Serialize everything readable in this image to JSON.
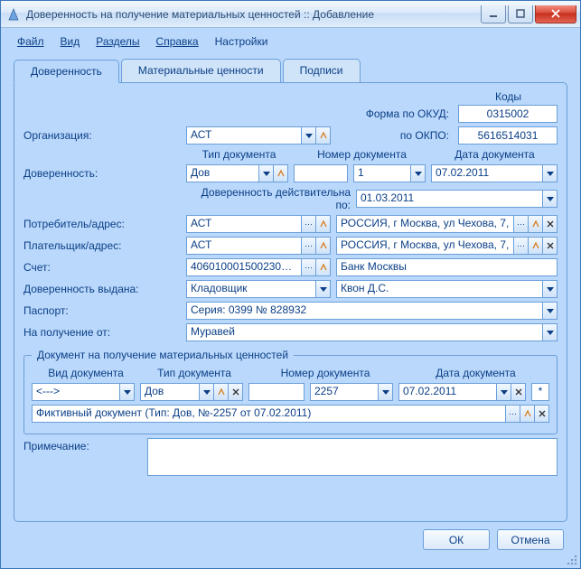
{
  "window": {
    "title": "Доверенность на получение материальных ценностей :: Добавление"
  },
  "menu": {
    "file": "Файл",
    "view": "Вид",
    "sections": "Разделы",
    "help": "Справка",
    "settings": "Настройки"
  },
  "tabs": {
    "t1": "Доверенность",
    "t2": "Материальные ценности",
    "t3": "Подписи"
  },
  "codes": {
    "header": "Коды",
    "okud_label": "Форма по ОКУД:",
    "okud_value": "0315002",
    "okpo_label": "по ОКПО:",
    "okpo_value": "5616514031"
  },
  "labels": {
    "org": "Организация:",
    "type": "Тип документа",
    "number": "Номер документа",
    "date": "Дата документа",
    "warrant": "Доверенность:",
    "valid_till": "Доверенность действительна по:",
    "consumer": "Потребитель/адрес:",
    "payer": "Плательщик/адрес:",
    "account": "Счет:",
    "issued_to": "Доверенность выдана:",
    "passport": "Паспорт:",
    "from": "На получение от:",
    "sub_legend": "Документ на получение материальных ценностей",
    "sub_vid": "Вид документа",
    "sub_type": "Тип документа",
    "sub_num": "Номер документа",
    "sub_date": "Дата документа",
    "note": "Примечание:"
  },
  "values": {
    "org": "АСТ",
    "warrant_type": "Дов",
    "warrant_num_left": "",
    "warrant_num_right": "1",
    "warrant_date": "07.02.2011",
    "valid_till": "01.03.2011",
    "consumer": "АСТ",
    "consumer_addr": "РОССИЯ, г Москва, ул Чехова, 7,",
    "payer": "АСТ",
    "payer_addr": "РОССИЯ, г Москва, ул Чехова, 7,",
    "account": "40601000150023002...",
    "bank": "Банк Москвы",
    "issued_role": "Кладовщик",
    "issued_name": "Квон Д.С.",
    "passport": "Серия: 0399 № 828932",
    "from": "Муравей",
    "sub_vid": "<--->",
    "sub_type": "Дов",
    "sub_num_left": "",
    "sub_num_right": "2257",
    "sub_date": "07.02.2011",
    "sub_star": "*",
    "sub_desc": "Фиктивный документ (Тип: Дов, №-2257 от 07.02.2011)",
    "note": ""
  },
  "buttons": {
    "ok": "ОК",
    "cancel": "Отмена"
  }
}
